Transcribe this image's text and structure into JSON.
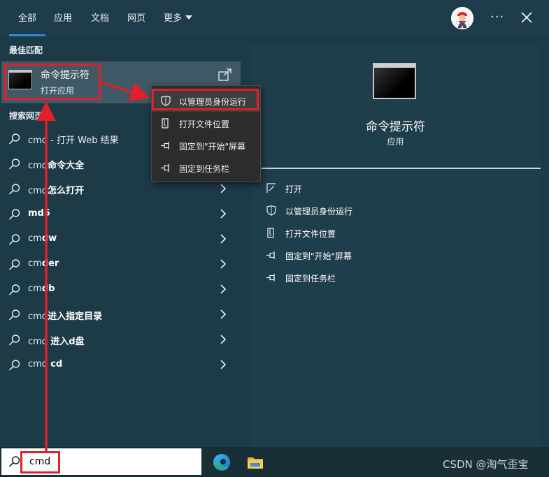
{
  "tabs": [
    {
      "label": "全部",
      "active": true
    },
    {
      "label": "应用"
    },
    {
      "label": "文档"
    },
    {
      "label": "网页"
    },
    {
      "label": "更多"
    }
  ],
  "best_match": {
    "section_label": "最佳匹配",
    "title": "命令提示符",
    "subtitle": "打开应用"
  },
  "web_section_label": "搜索网页",
  "suggestions": [
    {
      "pre": "cmd",
      "bold": "",
      "post": " - 打开 Web 结果",
      "chevron": false
    },
    {
      "pre": "cmd",
      "bold": "命令大全",
      "post": "",
      "chevron": false
    },
    {
      "pre": "cmd",
      "bold": "怎么打开",
      "post": "",
      "chevron": true
    },
    {
      "pre": "",
      "bold": "md5",
      "post": "",
      "chevron": true
    },
    {
      "pre": "cm",
      "bold": "dw",
      "post": "",
      "chevron": true
    },
    {
      "pre": "cm",
      "bold": "der",
      "post": "",
      "chevron": true
    },
    {
      "pre": "cm",
      "bold": "db",
      "post": "",
      "chevron": true
    },
    {
      "pre": "cmd",
      "bold": "进入指定目录",
      "post": "",
      "chevron": true
    },
    {
      "pre": "cmd ",
      "bold": "进入d盘",
      "post": "",
      "chevron": true
    },
    {
      "pre": "cmd ",
      "bold": "cd",
      "post": "",
      "chevron": true
    }
  ],
  "context_menu": [
    {
      "label": "以管理员身份运行",
      "icon": "shield-icon",
      "highlighted": true
    },
    {
      "label": "打开文件位置",
      "icon": "file-location-icon"
    },
    {
      "label": "固定到\"开始\"屏幕",
      "icon": "pin-icon"
    },
    {
      "label": "固定到任务栏",
      "icon": "pin-icon"
    }
  ],
  "preview": {
    "title": "命令提示符",
    "subtitle": "应用",
    "actions": [
      {
        "label": "打开",
        "icon": "open-icon"
      },
      {
        "label": "以管理员身份运行",
        "icon": "shield-icon"
      },
      {
        "label": "打开文件位置",
        "icon": "file-location-icon"
      },
      {
        "label": "固定到\"开始\"屏幕",
        "icon": "pin-icon"
      },
      {
        "label": "固定到任务栏",
        "icon": "pin-icon"
      }
    ]
  },
  "taskbar": {
    "search_value": "cmd",
    "watermark": "CSDN @淘气歪宝"
  },
  "colors": {
    "accent": "#2a8bd8",
    "annotation_red": "#e0202a",
    "panel_bg": "#1d3a47"
  }
}
